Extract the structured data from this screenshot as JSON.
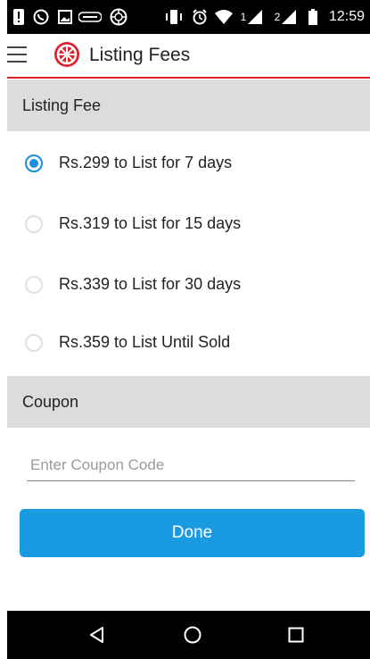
{
  "status_bar": {
    "time": "12:59",
    "sim1_label": "1",
    "sim2_label": "2",
    "icons": [
      "alert-icon",
      "whatsapp-icon",
      "image-icon",
      "ndtv-icon",
      "wheel-icon",
      "vibrate-icon",
      "alarm-icon",
      "wifi-icon",
      "signal-icon",
      "battery-icon"
    ]
  },
  "app_bar": {
    "title": "Listing Fees",
    "brand_color": "#e0202a"
  },
  "listing_fee": {
    "header": "Listing Fee",
    "options": [
      {
        "label": "Rs.299 to List for 7 days",
        "selected": true
      },
      {
        "label": "Rs.319 to List for 15 days",
        "selected": false
      },
      {
        "label": "Rs.339 to List for 30 days",
        "selected": false
      },
      {
        "label": "Rs.359 to List Until Sold",
        "selected": false
      }
    ]
  },
  "coupon": {
    "header": "Coupon",
    "placeholder": "Enter Coupon Code",
    "value": ""
  },
  "actions": {
    "done_label": "Done",
    "accent_color": "#1a9ae0"
  },
  "nav_bar": {
    "buttons": [
      "back-icon",
      "home-icon",
      "recents-icon"
    ]
  }
}
